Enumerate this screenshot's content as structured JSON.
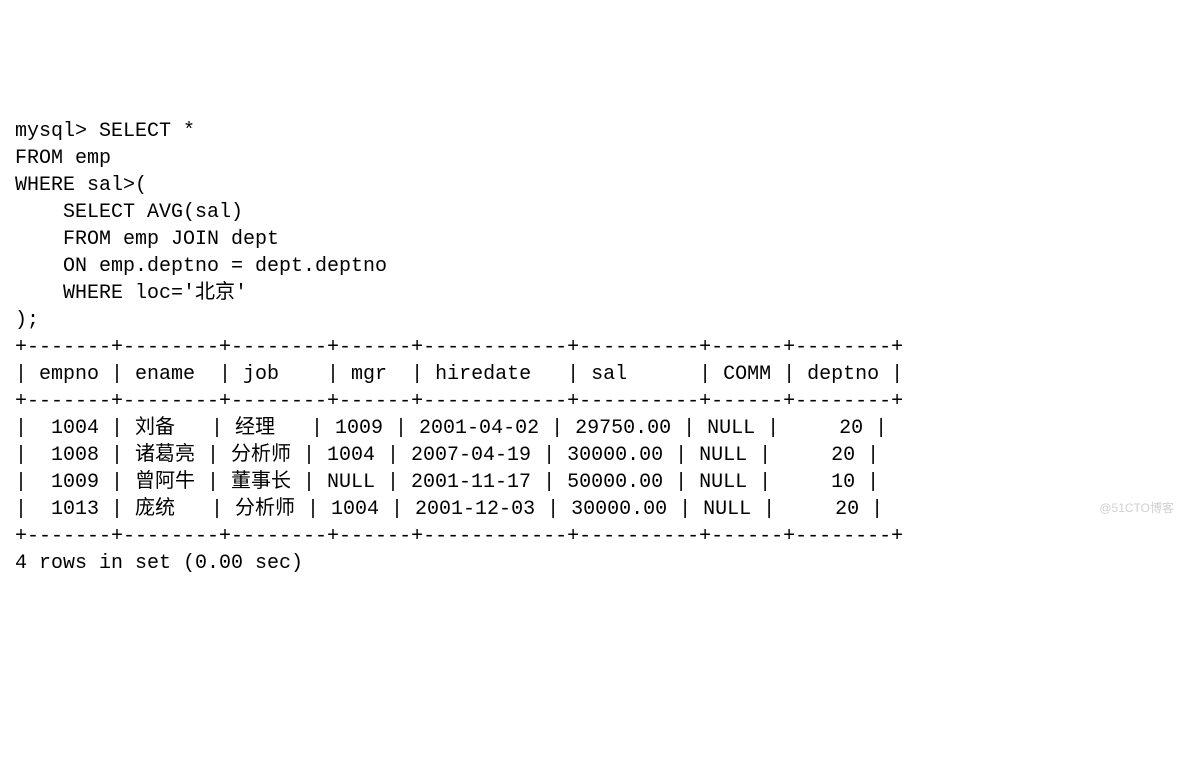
{
  "prompt": "mysql>",
  "query": {
    "line1": "SELECT *",
    "line2": "FROM emp",
    "line3": "WHERE sal>(",
    "line4": "    SELECT AVG(sal)",
    "line5": "    FROM emp JOIN dept",
    "line6": "    ON emp.deptno = dept.deptno",
    "line7": "    WHERE loc='北京'",
    "line8": ");"
  },
  "table": {
    "border": "+-------+--------+--------+------+------------+----------+------+--------+",
    "headers": [
      "empno",
      "ename",
      "job",
      "mgr",
      "hiredate",
      "sal",
      "COMM",
      "deptno"
    ],
    "rows": [
      {
        "empno": "1004",
        "ename": "刘备",
        "job": "经理",
        "mgr": "1009",
        "hiredate": "2001-04-02",
        "sal": "29750.00",
        "comm": "NULL",
        "deptno": "20"
      },
      {
        "empno": "1008",
        "ename": "诸葛亮",
        "job": "分析师",
        "mgr": "1004",
        "hiredate": "2007-04-19",
        "sal": "30000.00",
        "comm": "NULL",
        "deptno": "20"
      },
      {
        "empno": "1009",
        "ename": "曾阿牛",
        "job": "董事长",
        "mgr": "NULL",
        "hiredate": "2001-11-17",
        "sal": "50000.00",
        "comm": "NULL",
        "deptno": "10"
      },
      {
        "empno": "1013",
        "ename": "庞统",
        "job": "分析师",
        "mgr": "1004",
        "hiredate": "2001-12-03",
        "sal": "30000.00",
        "comm": "NULL",
        "deptno": "20"
      }
    ]
  },
  "footer": "4 rows in set (0.00 sec)",
  "watermark": "@51CTO博客"
}
